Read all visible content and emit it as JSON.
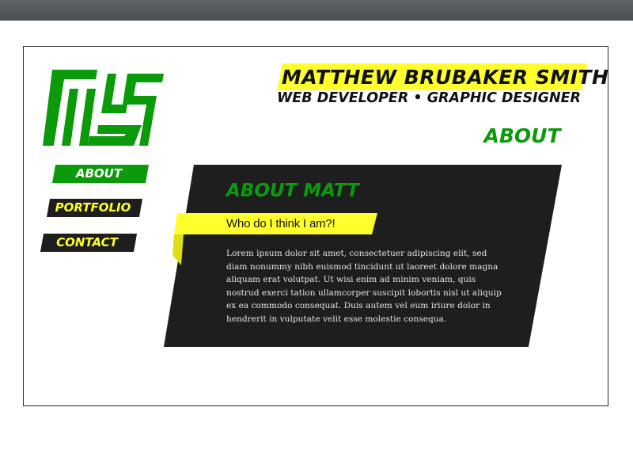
{
  "header": {
    "name": "MATTHEW BRUBAKER SMITH",
    "subtitle": "WEB DEVELOPER • GRAPHIC DESIGNER",
    "page_heading": "ABOUT"
  },
  "logo": {
    "icon": "mbs-monogram-logo",
    "color": "#0a9a0a"
  },
  "nav": {
    "items": [
      {
        "label": "ABOUT",
        "active": true
      },
      {
        "label": "PORTFOLIO",
        "active": false
      },
      {
        "label": "CONTACT",
        "active": false
      }
    ]
  },
  "card": {
    "title": "ABOUT MATT",
    "subtitle": "Who do I think I am?!",
    "body": "Lorem ipsum dolor sit amet, consectetuer adipiscing elit, sed diam nonummy nibh euismod tincidunt ut laoreet dolore magna aliquam erat volutpat. Ut wisi enim ad minim veniam, quis nostrud exerci tation ullamcorper suscipit lobortis nisl ut aliquip ex ea commodo consequat. Duis autem vel eum iriure dolor in hendrerit in vulputate velit esse molestie consequa."
  },
  "colors": {
    "accent_green": "#0a9a0a",
    "accent_yellow": "#ffff2e",
    "panel_dark": "#1e1e1e",
    "browser_bar": "#54585c"
  }
}
